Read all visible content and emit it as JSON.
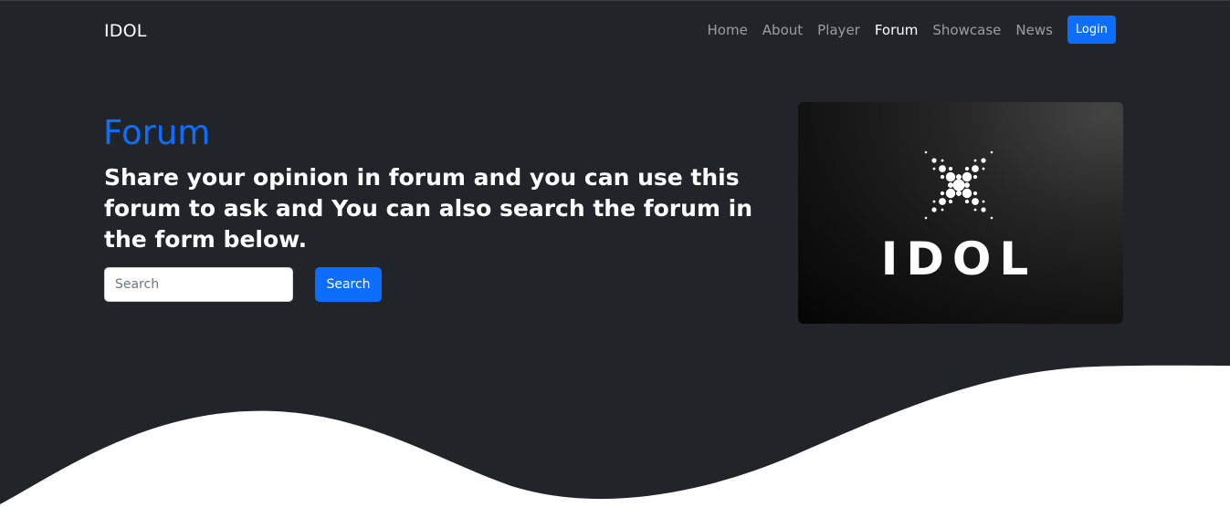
{
  "navbar": {
    "brand": "IDOL",
    "links": [
      {
        "label": "Home",
        "active": false
      },
      {
        "label": "About",
        "active": false
      },
      {
        "label": "Player",
        "active": false
      },
      {
        "label": "Forum",
        "active": true
      },
      {
        "label": "Showcase",
        "active": false
      },
      {
        "label": "News",
        "active": false
      }
    ],
    "login_label": "Login"
  },
  "hero": {
    "title": "Forum",
    "subtitle": "Share your opinion in forum and you can use this forum to ask and You can also search the forum in the form below.",
    "search_placeholder": "Search",
    "search_value": "",
    "search_button": "Search",
    "logo_text": "IDOL"
  },
  "colors": {
    "background": "#212529",
    "accent": "#0d6efd",
    "wave": "#ffffff",
    "text": "#ffffff",
    "nav_inactive": "rgba(255,255,255,0.55)"
  },
  "icons": {
    "logo": "idol-dotted-x-logo"
  }
}
